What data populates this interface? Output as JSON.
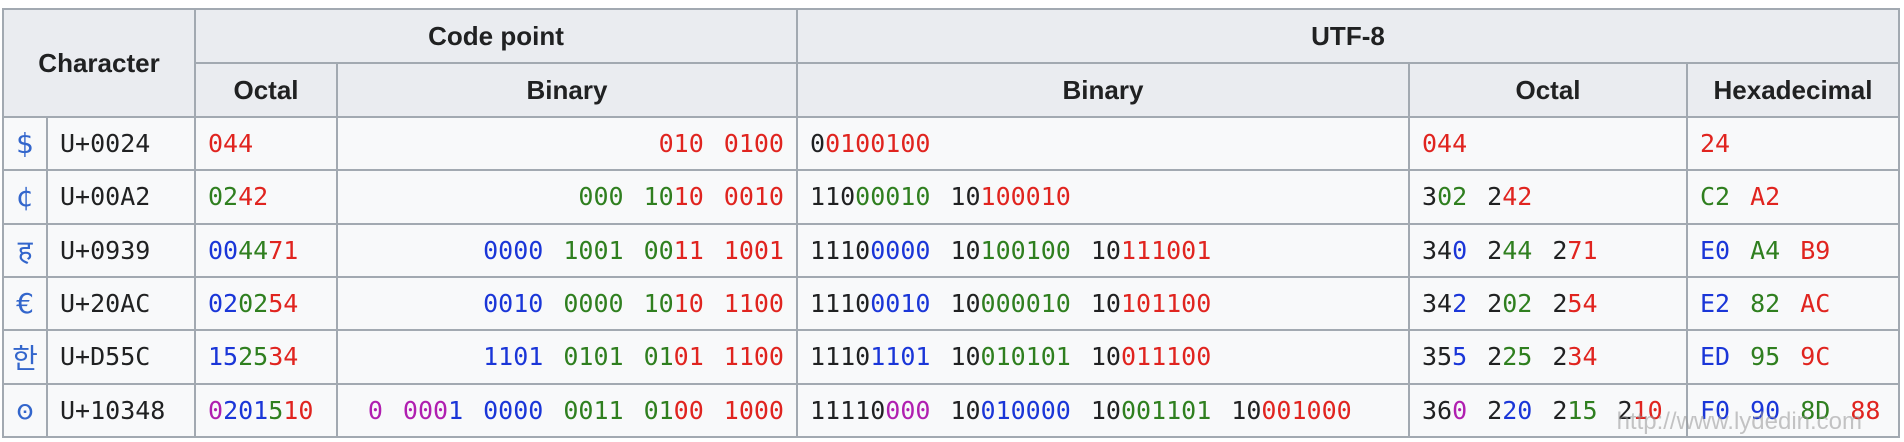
{
  "table": {
    "headers": {
      "character": "Character",
      "code_point": "Code point",
      "utf8": "UTF-8",
      "octal": "Octal",
      "binary": "Binary",
      "utf8_binary": "Binary",
      "utf8_octal": "Octal",
      "hexadecimal": "Hexadecimal"
    },
    "colors": {
      "black": "#202122",
      "red": "#e0241f",
      "green": "#2f7f1f",
      "blue": "#1a36d8",
      "purple": "#b01fb0",
      "link": "#3366cc"
    },
    "rows": [
      {
        "char": "$",
        "code": "U+0024",
        "octal": [
          [
            "r",
            "044"
          ]
        ],
        "binary": [
          [
            [
              "r",
              "010"
            ]
          ],
          [
            [
              "r",
              "0100"
            ]
          ]
        ],
        "utf8_binary": [
          [
            [
              "k",
              "0"
            ],
            [
              "r",
              "0100100"
            ]
          ]
        ],
        "utf8_octal": [
          [
            [
              "r",
              "044"
            ]
          ]
        ],
        "hex": [
          [
            [
              "r",
              "24"
            ]
          ]
        ]
      },
      {
        "char": "¢",
        "code": "U+00A2",
        "octal": [
          [
            "gr",
            "02"
          ],
          [
            "r",
            "42"
          ]
        ],
        "binary": [
          [
            [
              "gr",
              "000"
            ]
          ],
          [
            [
              "gr",
              "10"
            ],
            [
              "r",
              "10"
            ]
          ],
          [
            [
              "r",
              "0010"
            ]
          ]
        ],
        "utf8_binary": [
          [
            [
              "k",
              "110"
            ],
            [
              "gr",
              "00010"
            ]
          ],
          [
            [
              "k",
              "10"
            ],
            [
              "r",
              "100010"
            ]
          ]
        ],
        "utf8_octal": [
          [
            [
              "k",
              "3"
            ],
            [
              "gr",
              "02"
            ]
          ],
          [
            [
              "k",
              "2"
            ],
            [
              "r",
              "42"
            ]
          ]
        ],
        "hex": [
          [
            [
              "gr",
              "C2"
            ]
          ],
          [
            [
              "r",
              "A2"
            ]
          ]
        ]
      },
      {
        "char": "ह",
        "code": "U+0939",
        "octal": [
          [
            "b",
            "00"
          ],
          [
            "gr",
            "44"
          ],
          [
            "r",
            "71"
          ]
        ],
        "binary": [
          [
            [
              "b",
              "0000"
            ]
          ],
          [
            [
              "gr",
              "1001"
            ]
          ],
          [
            [
              "gr",
              "00"
            ],
            [
              "r",
              "11"
            ]
          ],
          [
            [
              "r",
              "1001"
            ]
          ]
        ],
        "utf8_binary": [
          [
            [
              "k",
              "1110"
            ],
            [
              "b",
              "0000"
            ]
          ],
          [
            [
              "k",
              "10"
            ],
            [
              "gr",
              "100100"
            ]
          ],
          [
            [
              "k",
              "10"
            ],
            [
              "r",
              "111001"
            ]
          ]
        ],
        "utf8_octal": [
          [
            [
              "k",
              "34"
            ],
            [
              "b",
              "0"
            ]
          ],
          [
            [
              "k",
              "2"
            ],
            [
              "gr",
              "44"
            ]
          ],
          [
            [
              "k",
              "2"
            ],
            [
              "r",
              "71"
            ]
          ]
        ],
        "hex": [
          [
            [
              "b",
              "E0"
            ]
          ],
          [
            [
              "gr",
              "A4"
            ]
          ],
          [
            [
              "r",
              "B9"
            ]
          ]
        ]
      },
      {
        "char": "€",
        "code": "U+20AC",
        "octal": [
          [
            "b",
            "02"
          ],
          [
            "gr",
            "02"
          ],
          [
            "r",
            "54"
          ]
        ],
        "binary": [
          [
            [
              "b",
              "0010"
            ]
          ],
          [
            [
              "gr",
              "0000"
            ]
          ],
          [
            [
              "gr",
              "10"
            ],
            [
              "r",
              "10"
            ]
          ],
          [
            [
              "r",
              "1100"
            ]
          ]
        ],
        "utf8_binary": [
          [
            [
              "k",
              "1110"
            ],
            [
              "b",
              "0010"
            ]
          ],
          [
            [
              "k",
              "10"
            ],
            [
              "gr",
              "000010"
            ]
          ],
          [
            [
              "k",
              "10"
            ],
            [
              "r",
              "101100"
            ]
          ]
        ],
        "utf8_octal": [
          [
            [
              "k",
              "34"
            ],
            [
              "b",
              "2"
            ]
          ],
          [
            [
              "k",
              "2"
            ],
            [
              "gr",
              "02"
            ]
          ],
          [
            [
              "k",
              "2"
            ],
            [
              "r",
              "54"
            ]
          ]
        ],
        "hex": [
          [
            [
              "b",
              "E2"
            ]
          ],
          [
            [
              "gr",
              "82"
            ]
          ],
          [
            [
              "r",
              "AC"
            ]
          ]
        ]
      },
      {
        "char": "한",
        "code": "U+D55C",
        "octal": [
          [
            "b",
            "15"
          ],
          [
            "gr",
            "25"
          ],
          [
            "r",
            "34"
          ]
        ],
        "binary": [
          [
            [
              "b",
              "1101"
            ]
          ],
          [
            [
              "gr",
              "0101"
            ]
          ],
          [
            [
              "gr",
              "01"
            ],
            [
              "r",
              "01"
            ]
          ],
          [
            [
              "r",
              "1100"
            ]
          ]
        ],
        "utf8_binary": [
          [
            [
              "k",
              "1110"
            ],
            [
              "b",
              "1101"
            ]
          ],
          [
            [
              "k",
              "10"
            ],
            [
              "gr",
              "010101"
            ]
          ],
          [
            [
              "k",
              "10"
            ],
            [
              "r",
              "011100"
            ]
          ]
        ],
        "utf8_octal": [
          [
            [
              "k",
              "35"
            ],
            [
              "b",
              "5"
            ]
          ],
          [
            [
              "k",
              "2"
            ],
            [
              "gr",
              "25"
            ]
          ],
          [
            [
              "k",
              "2"
            ],
            [
              "r",
              "34"
            ]
          ]
        ],
        "hex": [
          [
            [
              "b",
              "ED"
            ]
          ],
          [
            [
              "gr",
              "95"
            ]
          ],
          [
            [
              "r",
              "9C"
            ]
          ]
        ]
      },
      {
        "char": "𐍈",
        "code": "U+10348",
        "octal": [
          [
            "p",
            "0"
          ],
          [
            "b",
            "2"
          ],
          [
            "b",
            "01"
          ],
          [
            "gr",
            "5"
          ],
          [
            "r",
            "10"
          ]
        ],
        "binary": [
          [
            [
              "p",
              "0"
            ]
          ],
          [
            [
              "p",
              "0"
            ],
            [
              "p",
              "00"
            ],
            [
              "b",
              "1"
            ]
          ],
          [
            [
              "b",
              "0000"
            ]
          ],
          [
            [
              "gr",
              "0011"
            ]
          ],
          [
            [
              "gr",
              "01"
            ],
            [
              "r",
              "00"
            ]
          ],
          [
            [
              "r",
              "1000"
            ]
          ]
        ],
        "utf8_binary": [
          [
            [
              "k",
              "11110"
            ],
            [
              "p",
              "000"
            ]
          ],
          [
            [
              "k",
              "10"
            ],
            [
              "b",
              "010000"
            ]
          ],
          [
            [
              "k",
              "10"
            ],
            [
              "gr",
              "001101"
            ]
          ],
          [
            [
              "k",
              "10"
            ],
            [
              "r",
              "001000"
            ]
          ]
        ],
        "utf8_octal": [
          [
            [
              "k",
              "36"
            ],
            [
              "p",
              "0"
            ]
          ],
          [
            [
              "k",
              "2"
            ],
            [
              "b",
              "20"
            ]
          ],
          [
            [
              "k",
              "2"
            ],
            [
              "gr",
              "15"
            ]
          ],
          [
            [
              "k",
              "2"
            ],
            [
              "r",
              "10"
            ]
          ]
        ],
        "hex": [
          [
            [
              "b",
              "F0"
            ]
          ],
          [
            [
              "b",
              "90"
            ]
          ],
          [
            [
              "gr",
              "8D"
            ]
          ],
          [
            [
              "r",
              "88"
            ]
          ]
        ]
      }
    ]
  },
  "watermark": "http://www.lydedin.com"
}
